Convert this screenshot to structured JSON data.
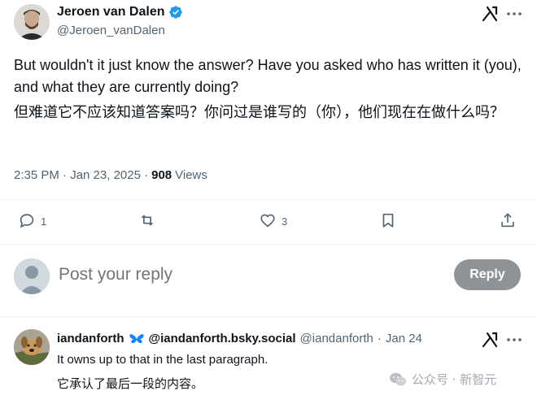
{
  "post": {
    "author_name": "Jeroen van Dalen",
    "author_handle": "@Jeroen_vanDalen",
    "text_en": "But wouldn't it just know the answer? Have you  asked who has written it (you), and what they are currently doing?",
    "text_zh": "但难道它不应该知道答案吗？你问过是谁写的（你），他们现在在做什么吗？",
    "timestamp": "2:35 PM · Jan 23, 2025 ·",
    "views_count": "908",
    "views_label": "Views",
    "icons": {
      "verified": "verified-badge-icon",
      "grok": "grok-icon",
      "more": "more-icon"
    }
  },
  "actions": {
    "replies": "1",
    "reposts": "",
    "likes": "3",
    "icons": [
      "reply-icon",
      "repost-icon",
      "like-icon",
      "bookmark-icon",
      "share-icon"
    ]
  },
  "reply_box": {
    "placeholder": "Post your reply",
    "button_label": "Reply"
  },
  "reply_post": {
    "name": "iandanforth",
    "display": "@iandanforth.bsky.social",
    "handle": "@iandanforth",
    "dot": "·",
    "date": "Jan 24",
    "text_en": "It owns up to that in the last paragraph.",
    "text_zh": "它承认了最后一段的内容。"
  },
  "watermark": {
    "text": "公众号 · 新智元"
  },
  "colors": {
    "text_primary": "#0f1419",
    "text_secondary": "#536471",
    "verified_blue": "#1d9bf0",
    "reply_button": "#8e9397",
    "divider": "#eff3f4"
  }
}
